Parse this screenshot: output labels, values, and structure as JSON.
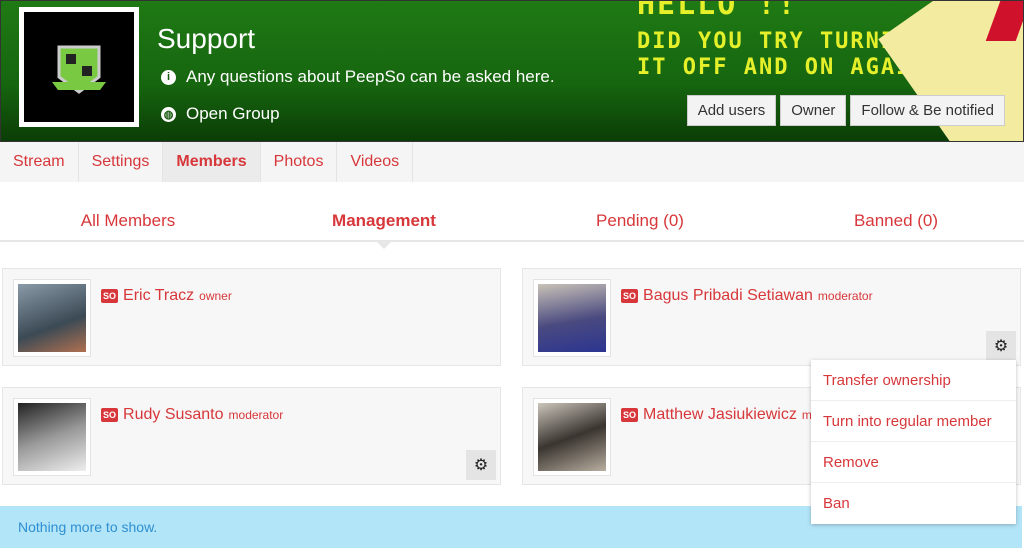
{
  "group": {
    "name": "Support",
    "description": "Any questions about PeepSo can be asked here.",
    "privacy": "Open Group",
    "cover_text": [
      "HELLO !!",
      "DID YOU TRY TURNING",
      "IT OFF AND ON AGAIN?"
    ]
  },
  "actions": {
    "add_users": "Add users",
    "owner": "Owner",
    "follow": "Follow & Be notified"
  },
  "tabs": [
    "Stream",
    "Settings",
    "Members",
    "Photos",
    "Videos"
  ],
  "active_tab": "Members",
  "subtabs": [
    "All Members",
    "Management",
    "Pending (0)",
    "Banned (0)"
  ],
  "active_subtab": "Management",
  "members": [
    {
      "name": "Eric Tracz",
      "role": "owner"
    },
    {
      "name": "Bagus Pribadi Setiawan",
      "role": "moderator"
    },
    {
      "name": "Rudy Susanto",
      "role": "moderator"
    },
    {
      "name": "Matthew Jasiukiewicz",
      "role": "moderator"
    }
  ],
  "badge": "SO",
  "menu": [
    "Transfer ownership",
    "Turn into regular member",
    "Remove",
    "Ban"
  ],
  "footer_message": "Nothing more to show.",
  "colors": {
    "accent": "#d7373a",
    "cover": "#1f7a14",
    "info": "#b3e5f9"
  }
}
